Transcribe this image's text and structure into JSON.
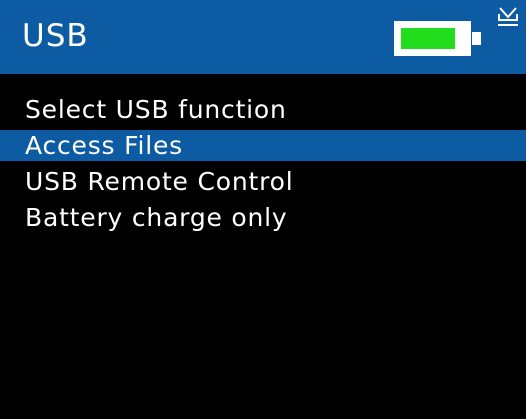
{
  "header": {
    "title": "USB",
    "accent_color": "#0d5ba3"
  },
  "status": {
    "battery_icon": "battery-icon",
    "battery_level": 0.85,
    "battery_fill_color": "#22dd1b",
    "usb_icon": "usb-connected-icon"
  },
  "menu": {
    "prompt": "Select USB function",
    "items": [
      {
        "label": "Access Files",
        "selected": true
      },
      {
        "label": "USB Remote Control",
        "selected": false
      },
      {
        "label": "Battery charge only",
        "selected": false
      }
    ]
  }
}
